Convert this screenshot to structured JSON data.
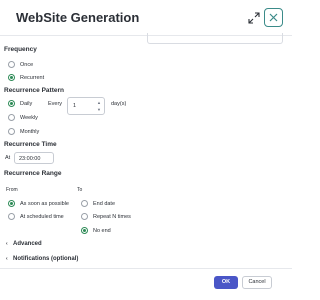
{
  "dialog": {
    "title": "WebSite Generation",
    "expand_icon": "expand-arrows-icon",
    "close_icon": "close-x-icon"
  },
  "frequency": {
    "label": "Frequency",
    "options": [
      {
        "label": "Once",
        "selected": false
      },
      {
        "label": "Recurrent",
        "selected": true
      }
    ]
  },
  "recurrence_pattern": {
    "label": "Recurrence Pattern",
    "options": [
      {
        "label": "Daily",
        "selected": true
      },
      {
        "label": "Weekly",
        "selected": false
      },
      {
        "label": "Monthly",
        "selected": false
      }
    ],
    "every_label": "Every",
    "every_value": "1",
    "unit_label": "day(s)"
  },
  "recurrence_time": {
    "label": "Recurrence Time",
    "at_label": "At",
    "time_value": "23:00:00"
  },
  "recurrence_range": {
    "label": "Recurrence Range",
    "from_label": "From",
    "to_label": "To",
    "from_options": [
      {
        "label": "As soon as possible",
        "selected": true
      },
      {
        "label": "At scheduled time",
        "selected": false
      }
    ],
    "to_options": [
      {
        "label": "End date",
        "selected": false
      },
      {
        "label": "Repeat N times",
        "selected": false
      },
      {
        "label": "No end",
        "selected": true
      }
    ]
  },
  "collapsibles": {
    "advanced": "Advanced",
    "notifications": "Notifications (optional)"
  },
  "footer": {
    "ok_label": "OK",
    "cancel_label": "Cancel"
  },
  "colors": {
    "accent_green": "#2e8b57",
    "primary_button": "#4a56c7",
    "close_border": "#3b8b89"
  }
}
